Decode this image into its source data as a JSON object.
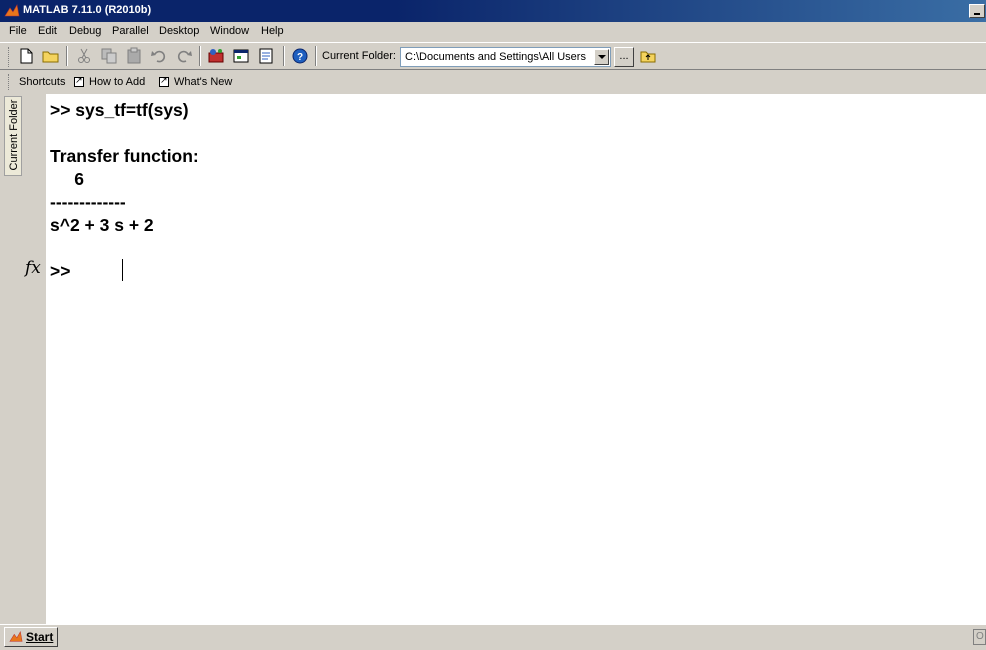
{
  "window": {
    "title": "MATLAB  7.11.0 (R2010b)"
  },
  "menu": [
    {
      "label": "File"
    },
    {
      "label": "Edit"
    },
    {
      "label": "Debug"
    },
    {
      "label": "Parallel"
    },
    {
      "label": "Desktop"
    },
    {
      "label": "Window"
    },
    {
      "label": "Help"
    }
  ],
  "toolbar": {
    "current_folder_label": "Current Folder:",
    "current_folder_value": "C:\\Documents and Settings\\All Users",
    "browse_label": "..."
  },
  "shortcuts": {
    "label": "Shortcuts",
    "items": [
      {
        "label": "How to Add"
      },
      {
        "label": "What's New"
      }
    ]
  },
  "sidebar": {
    "tab_label": "Current Folder",
    "fx_label": "fx"
  },
  "console": {
    "lines": [
      ">> sys_tf=tf(sys)",
      "Transfer function:",
      "     6",
      "-------------",
      "s^2 + 3 s + 2"
    ],
    "prompt": ">>"
  },
  "statusbar": {
    "start_label": "Start",
    "end_text": "O"
  },
  "colors": {
    "title_bar": "#0a246a",
    "chrome": "#d4d0c8",
    "console_bg": "#ffffff"
  }
}
